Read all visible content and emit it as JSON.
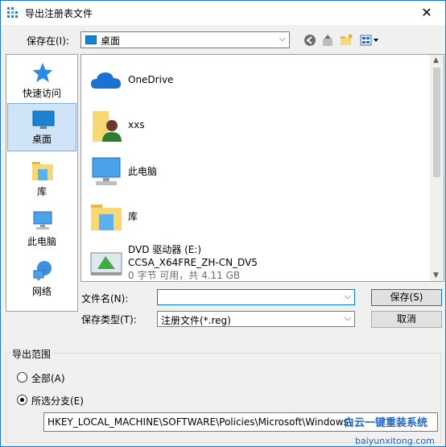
{
  "window": {
    "title": "导出注册表文件",
    "close_symbol": "✕"
  },
  "toolbar": {
    "save_in_label": "保存在(I):",
    "location_value": "桌面",
    "back_icon": "back-arrow-icon",
    "up_icon": "up-folder-icon",
    "new_folder_icon": "new-folder-icon",
    "view_icon": "view-menu-icon"
  },
  "places": [
    {
      "label": "快速访问",
      "icon": "star-icon",
      "selected": false
    },
    {
      "label": "桌面",
      "icon": "desktop-icon",
      "selected": true
    },
    {
      "label": "库",
      "icon": "library-icon",
      "selected": false
    },
    {
      "label": "此电脑",
      "icon": "computer-icon",
      "selected": false
    },
    {
      "label": "网络",
      "icon": "network-icon",
      "selected": false
    }
  ],
  "files": [
    {
      "name": "OneDrive",
      "icon": "onedrive-icon"
    },
    {
      "name": "xxs",
      "icon": "user-folder-icon"
    },
    {
      "name": "此电脑",
      "icon": "computer-icon"
    },
    {
      "name": "库",
      "icon": "library-icon"
    },
    {
      "name": "DVD 驱动器 (E:)",
      "line2": "CCSA_X64FRE_ZH-CN_DV5",
      "line3": "0 字节 可用，共 4.11 GB",
      "icon": "dvd-drive-icon"
    }
  ],
  "form": {
    "filename_label": "文件名(N):",
    "filename_value": "",
    "filetype_label": "保存类型(T):",
    "filetype_value": "注册文件(*.reg)",
    "save_button": "保存(S)",
    "cancel_button": "取消"
  },
  "export_range": {
    "title": "导出范围",
    "all_label": "全部(A)",
    "selected_label": "所选分支(E)",
    "selected_checked": true,
    "path_value": "HKEY_LOCAL_MACHINE\\SOFTWARE\\Policies\\Microsoft\\Windows\\"
  },
  "watermark": {
    "text": "白云一键重装系统",
    "url": "baiyunxitong.com"
  },
  "colors": {
    "accent": "#0078d7",
    "selected_bg": "#cfe4f7",
    "folder_yellow": "#f8d775"
  }
}
